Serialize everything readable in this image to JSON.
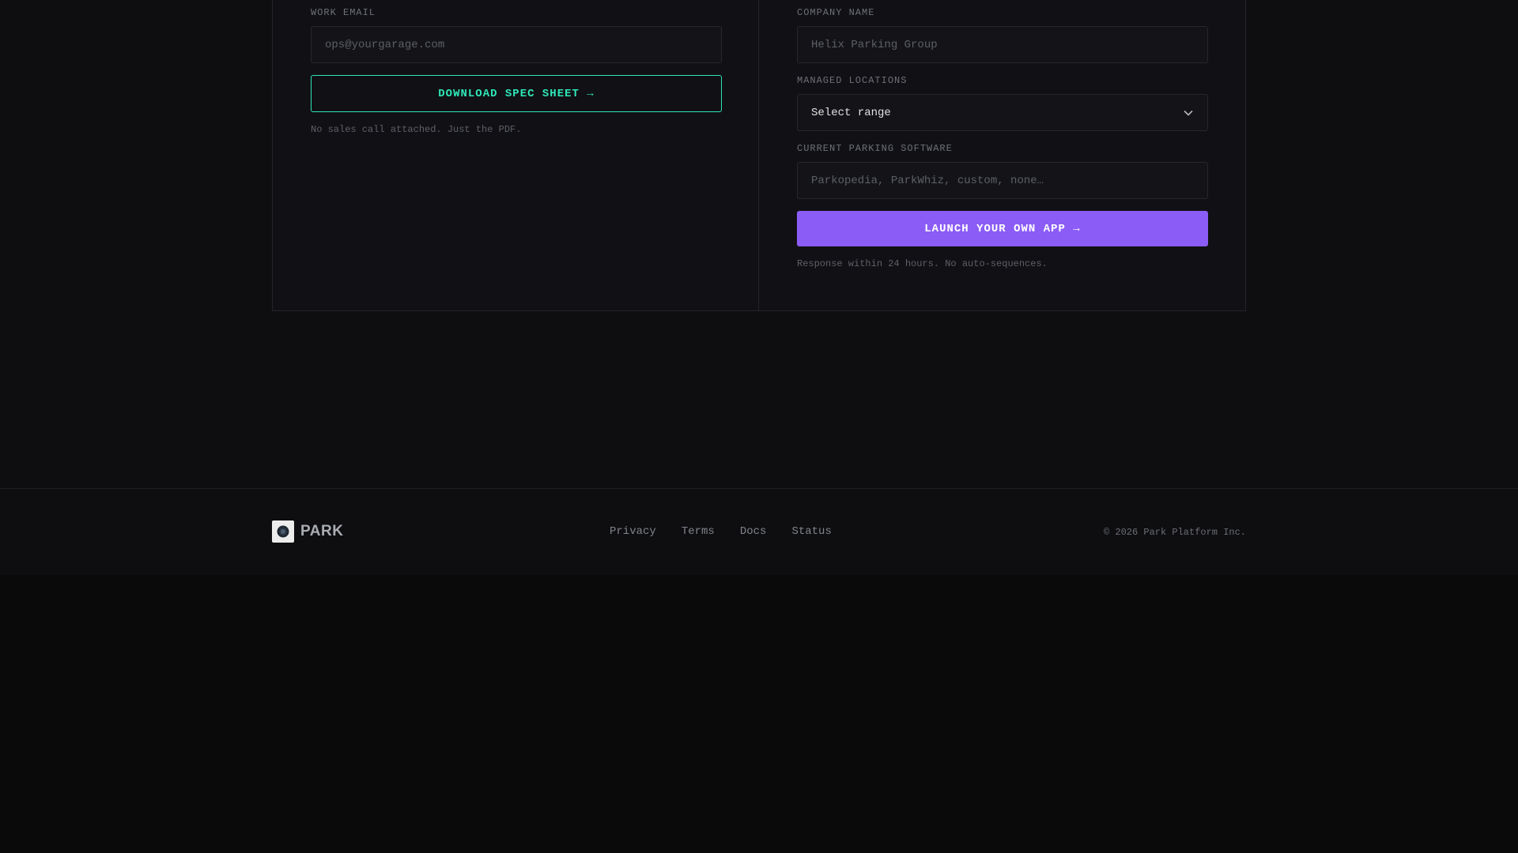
{
  "left_form": {
    "email_label": "WORK EMAIL",
    "email_placeholder": "ops@yourgarage.com",
    "download_button": "DOWNLOAD SPEC SHEET →",
    "note": "No sales call attached. Just the PDF."
  },
  "right_form": {
    "company_label": "COMPANY NAME",
    "company_placeholder": "Helix Parking Group",
    "locations_label": "MANAGED LOCATIONS",
    "locations_value": "Select range",
    "software_label": "CURRENT PARKING SOFTWARE",
    "software_placeholder": "Parkopedia, ParkWhiz, custom, none…",
    "launch_button": "LAUNCH YOUR OWN APP →",
    "note": "Response within 24 hours. No auto-sequences."
  },
  "footer": {
    "brand": "PARK",
    "links": [
      "Privacy",
      "Terms",
      "Docs",
      "Status"
    ],
    "copyright": "© 2026 Park Platform Inc."
  },
  "colors": {
    "accent_teal": "#2ee6b8",
    "accent_purple": "#8b5cf6",
    "background": "#0a0a0b"
  },
  "icons": {
    "select": "chevron-down-icon",
    "logo": "park-logo-icon"
  }
}
